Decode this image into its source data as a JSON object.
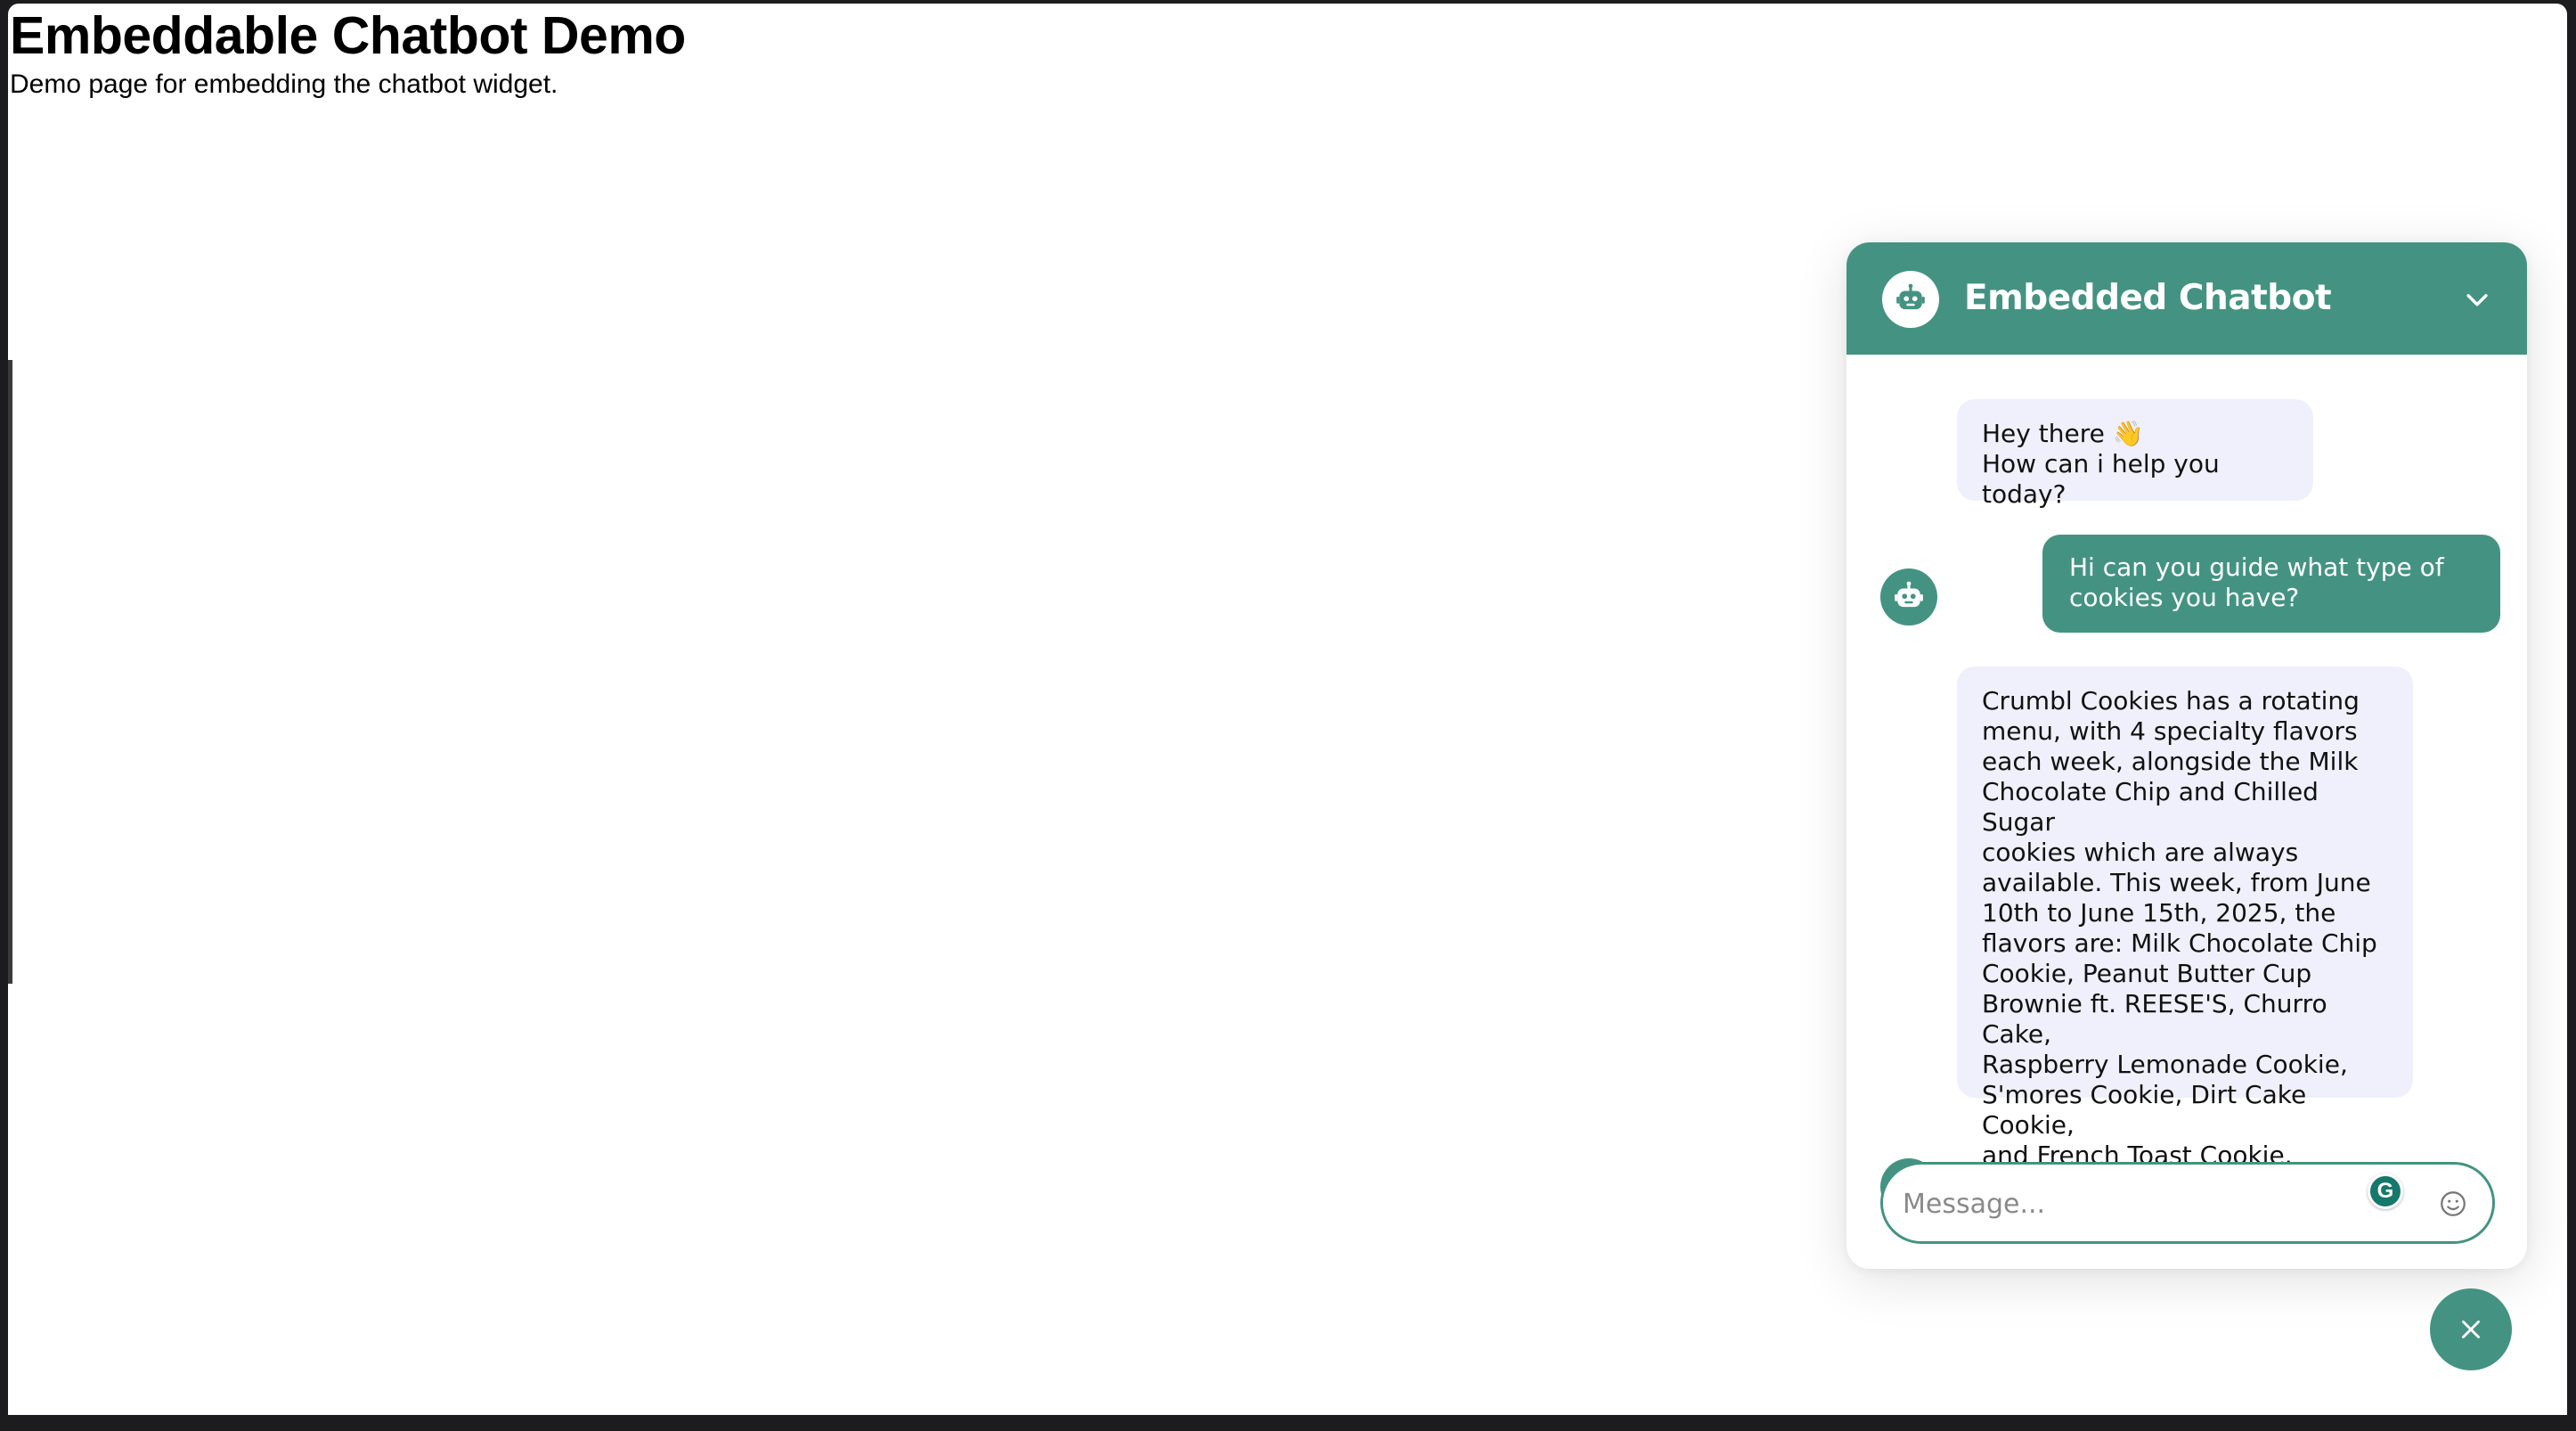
{
  "page": {
    "title": "Embeddable Chatbot Demo",
    "subtitle": "Demo page for embedding the chatbot widget."
  },
  "chat": {
    "title": "Embedded Chatbot",
    "header_avatar_icon": "robot-icon",
    "collapse_icon": "chevron-down-icon",
    "messages": [
      {
        "sender": "bot",
        "text": "Hey there 👋\nHow can i help you today?"
      },
      {
        "sender": "user",
        "text": "Hi can you guide what type of\ncookies you have?"
      },
      {
        "sender": "bot",
        "text": "Crumbl Cookies has a rotating\nmenu, with 4 specialty flavors\neach week, alongside the Milk\nChocolate Chip and Chilled Sugar\ncookies which are always\navailable. This week, from June\n10th to June 15th, 2025, the\nflavors are: Milk Chocolate Chip\nCookie, Peanut Butter Cup\nBrownie ft. REESE'S, Churro Cake,\nRaspberry Lemonade Cookie,\nS'mores Cookie, Dirt Cake Cookie,\nand French Toast Cookie."
      }
    ],
    "input": {
      "placeholder": "Message...",
      "value": ""
    },
    "grammar_badge": "G",
    "emoji_icon": "smiley-icon",
    "fab_icon": "close-icon"
  },
  "colors": {
    "accent": "#449382",
    "bot_bubble": "#f0f0fc",
    "page_bg": "#ffffff"
  }
}
